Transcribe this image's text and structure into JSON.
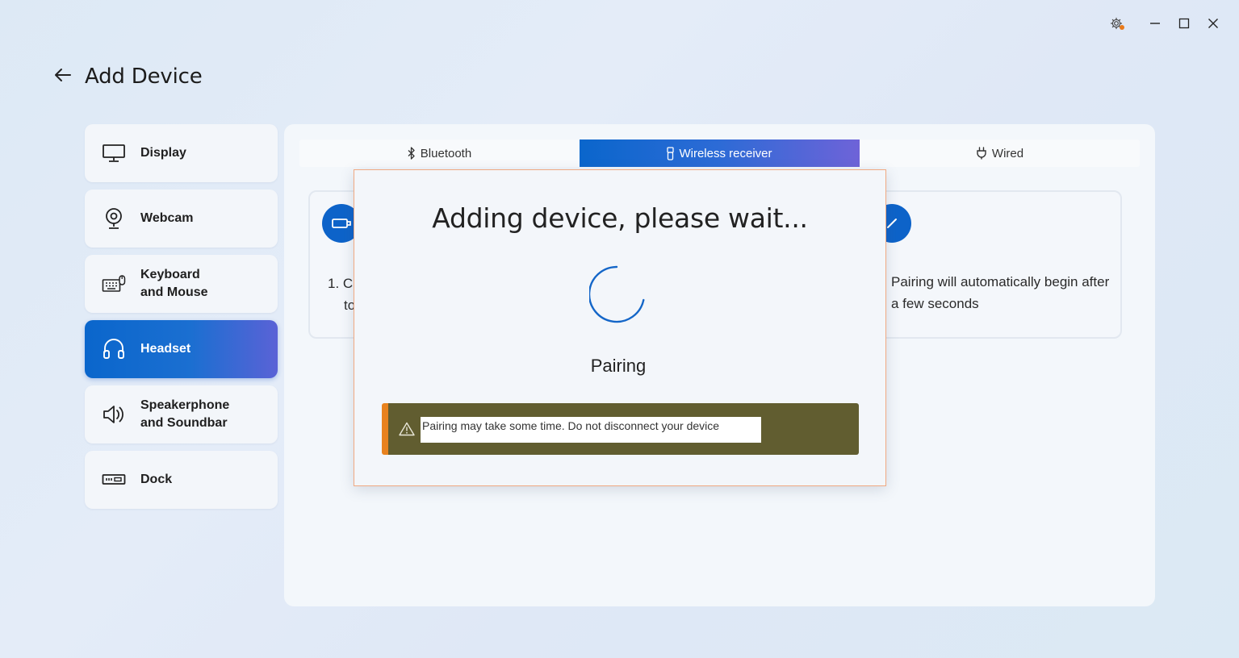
{
  "window": {
    "controls": [
      "settings-icon",
      "minimize-icon",
      "maximize-icon",
      "close-icon"
    ],
    "settings_badge_color": "#e97a1a"
  },
  "header": {
    "title": "Add Device",
    "back_icon": "back-arrow-icon"
  },
  "sidebar": {
    "items": [
      {
        "label": "Display",
        "icon": "monitor-icon",
        "active": false
      },
      {
        "label": "Webcam",
        "icon": "webcam-icon",
        "active": false
      },
      {
        "label": "Keyboard\nand Mouse",
        "icon": "keyboard-mouse-icon",
        "active": false
      },
      {
        "label": "Headset",
        "icon": "headset-icon",
        "active": true
      },
      {
        "label": "Speakerphone\nand Soundbar",
        "icon": "speaker-icon",
        "active": false
      },
      {
        "label": "Dock",
        "icon": "dock-icon",
        "active": false
      }
    ]
  },
  "tabs": [
    {
      "label": "Bluetooth",
      "icon": "bluetooth-icon",
      "active": false
    },
    {
      "label": "Wireless receiver",
      "icon": "usb-receiver-icon",
      "active": true
    },
    {
      "label": "Wired",
      "icon": "plug-icon",
      "active": false
    }
  ],
  "steps": {
    "left_text_line1": "1. C",
    "left_text_line2": "to",
    "right_text": "Pairing will automatically begin after a few seconds"
  },
  "modal": {
    "title": "Adding device, please wait...",
    "status": "Pairing",
    "warning": "Pairing may take some time. Do not disconnect your device"
  },
  "colors": {
    "accent": "#0a66cc",
    "accent_gradient_end": "#6e63d8",
    "warning_bg": "#615d30",
    "warning_edge": "#e8821e",
    "modal_border": "#f0a982"
  }
}
